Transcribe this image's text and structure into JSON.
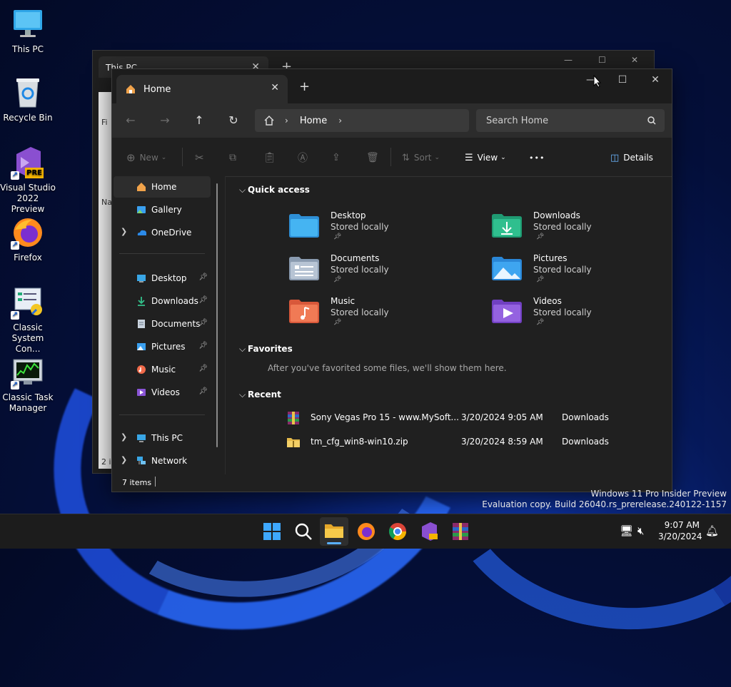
{
  "desktop": {
    "icons": [
      {
        "label": "This PC"
      },
      {
        "label": "Recycle Bin"
      },
      {
        "label": "Visual Studio 2022 Preview",
        "badge": "PRE"
      },
      {
        "label": "Firefox"
      },
      {
        "label": "Classic System Con..."
      },
      {
        "label": "Classic Task Manager"
      }
    ],
    "watermark": {
      "line1": "Windows 11 Pro Insider Preview",
      "line2": "Evaluation copy. Build 26040.rs_prerelease.240122-1157"
    }
  },
  "back_window": {
    "tab_title": "This PC",
    "new_tab": "+",
    "fragments": [
      "Fi",
      "Na",
      "2 i"
    ]
  },
  "window": {
    "tab_title": "Home",
    "tab_close": "✕",
    "new_tab": "+",
    "controls": {
      "minimize": "—",
      "maximize": "☐",
      "close": "✕"
    },
    "address": {
      "crumb": "Home",
      "sep1": "›",
      "sep2": "›"
    },
    "search": {
      "placeholder": "Search Home"
    },
    "commands": {
      "new": "New",
      "sort": "Sort",
      "view": "View",
      "more": "•••",
      "details": "Details"
    },
    "sidebar": {
      "top": [
        {
          "label": "Home"
        },
        {
          "label": "Gallery"
        },
        {
          "label": "OneDrive"
        }
      ],
      "pinned": [
        {
          "label": "Desktop"
        },
        {
          "label": "Downloads"
        },
        {
          "label": "Documents"
        },
        {
          "label": "Pictures"
        },
        {
          "label": "Music"
        },
        {
          "label": "Videos"
        }
      ],
      "bottom": [
        {
          "label": "This PC"
        },
        {
          "label": "Network"
        }
      ]
    },
    "quick_access": {
      "title": "Quick access",
      "items": [
        {
          "name": "Desktop",
          "status": "Stored locally"
        },
        {
          "name": "Downloads",
          "status": "Stored locally"
        },
        {
          "name": "Documents",
          "status": "Stored locally"
        },
        {
          "name": "Pictures",
          "status": "Stored locally"
        },
        {
          "name": "Music",
          "status": "Stored locally"
        },
        {
          "name": "Videos",
          "status": "Stored locally"
        }
      ]
    },
    "favorites": {
      "title": "Favorites",
      "empty": "After you've favorited some files, we'll show them here."
    },
    "recent": {
      "title": "Recent",
      "rows": [
        {
          "name": "Sony Vegas Pro 15 - www.MySoft...",
          "date": "3/20/2024 9:05 AM",
          "location": "Downloads"
        },
        {
          "name": "tm_cfg_win8-win10.zip",
          "date": "3/20/2024 8:59 AM",
          "location": "Downloads"
        }
      ]
    },
    "status": {
      "items": "7 items"
    }
  },
  "taskbar": {
    "time": "9:07 AM",
    "date": "3/20/2024",
    "pinned": [
      "start",
      "search",
      "file-explorer",
      "firefox",
      "chrome",
      "visual-studio-preview",
      "winrar"
    ]
  }
}
